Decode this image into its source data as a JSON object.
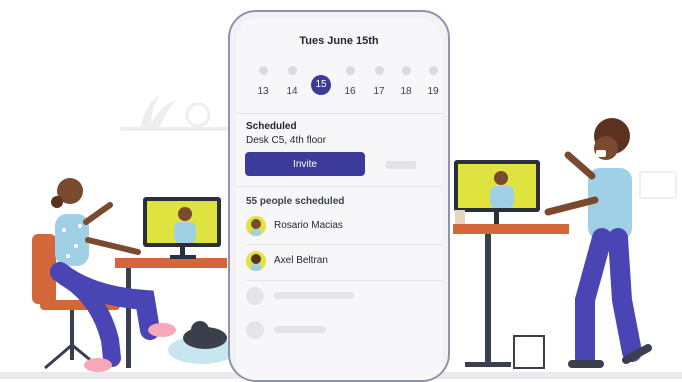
{
  "calendar": {
    "date_title": "Tues June 15th",
    "days": [
      "13",
      "14",
      "15",
      "16",
      "17",
      "18",
      "19"
    ],
    "selected_day": "15"
  },
  "schedule": {
    "label": "Scheduled",
    "desk": "Desk C5, 4th floor",
    "invite_label": "Invite"
  },
  "attendees": {
    "count_label": "55  people scheduled",
    "people": [
      {
        "name": "Rosario Macias"
      },
      {
        "name": "Axel Beltran"
      }
    ]
  },
  "colors": {
    "accent": "#3d3b9a",
    "avatar_bg": "#dfe33f",
    "shirt": "#9fd0e6",
    "pants": "#4a45b5",
    "chair": "#d4673a"
  }
}
